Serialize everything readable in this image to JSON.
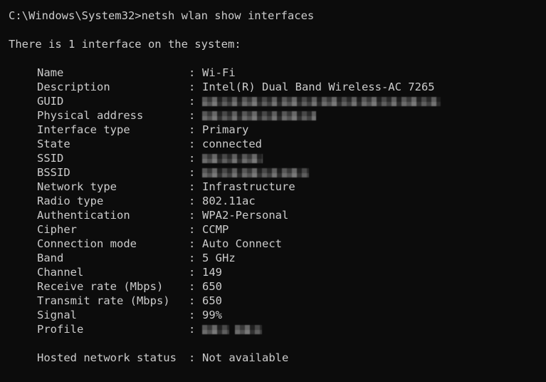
{
  "terminal": {
    "background_color": "#0c0c0c",
    "text_color": "#cccccc",
    "prompt_line": "C:\\Windows\\System32>netsh wlan show interfaces",
    "summary_line": "There is 1 interface on the system:",
    "colon": ":"
  },
  "interface": {
    "rows": [
      {
        "label": "Name",
        "value": "Wi-Fi",
        "redacted": false
      },
      {
        "label": "Description",
        "value": "Intel(R) Dual Band Wireless-AC 7265",
        "redacted": false
      },
      {
        "label": "GUID",
        "value": "",
        "redacted": true,
        "redaction_widths": [
          335
        ]
      },
      {
        "label": "Physical address",
        "value": "",
        "redacted": true,
        "redaction_widths": [
          160
        ]
      },
      {
        "label": "Interface type",
        "value": "Primary",
        "redacted": false
      },
      {
        "label": "State",
        "value": "connected",
        "redacted": false
      },
      {
        "label": "SSID",
        "value": "",
        "redacted": true,
        "redaction_widths": [
          85
        ]
      },
      {
        "label": "BSSID",
        "value": "",
        "redacted": true,
        "redaction_widths": [
          150
        ]
      },
      {
        "label": "Network type",
        "value": "Infrastructure",
        "redacted": false
      },
      {
        "label": "Radio type",
        "value": "802.11ac",
        "redacted": false
      },
      {
        "label": "Authentication",
        "value": "WPA2-Personal",
        "redacted": false
      },
      {
        "label": "Cipher",
        "value": "CCMP",
        "redacted": false
      },
      {
        "label": "Connection mode",
        "value": "Auto Connect",
        "redacted": false
      },
      {
        "label": "Band",
        "value": "5 GHz",
        "redacted": false
      },
      {
        "label": "Channel",
        "value": "149",
        "redacted": false
      },
      {
        "label": "Receive rate (Mbps)",
        "value": "650",
        "redacted": false
      },
      {
        "label": "Transmit rate (Mbps)",
        "value": "650",
        "redacted": false
      },
      {
        "label": "Signal",
        "value": "99%",
        "redacted": false
      },
      {
        "label": "Profile",
        "value": "",
        "redacted": true,
        "redaction_widths": [
          38,
          38
        ]
      }
    ]
  },
  "hosted_network": {
    "label": "Hosted network status",
    "value": "Not available"
  }
}
